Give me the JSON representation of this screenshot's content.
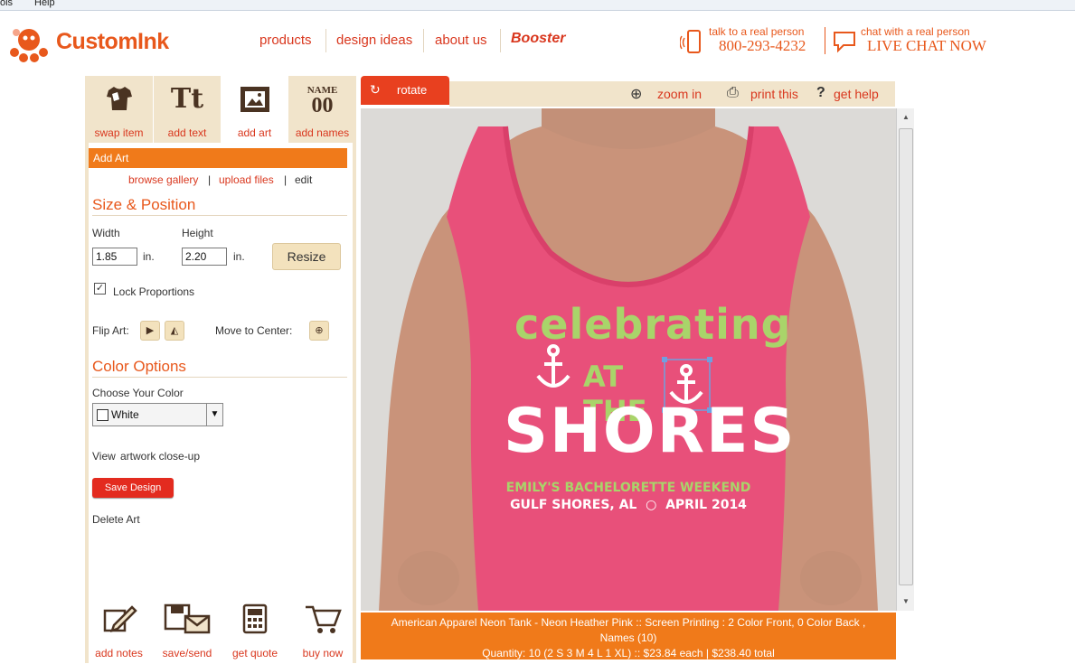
{
  "menubar": {
    "tools": "ols",
    "help": "Help"
  },
  "header": {
    "logo_text": "CustomInk",
    "nav": [
      "products",
      "design ideas",
      "about us"
    ],
    "booster": "Booster",
    "phone_label": "talk to a real person",
    "phone_number": "800-293-4232",
    "chat_label": "chat with a real person",
    "chat_action": "LIVE CHAT NOW"
  },
  "tools": [
    {
      "label": "swap item",
      "icon": "tshirt-icon"
    },
    {
      "label": "add text",
      "icon": "text-icon",
      "glyph": "Tt"
    },
    {
      "label": "add art",
      "icon": "picture-frame-icon"
    },
    {
      "label": "add names",
      "icon": "name-number-icon",
      "glyph_top": "NAME",
      "glyph_bottom": "00"
    }
  ],
  "add_art": {
    "title": "Add Art",
    "links": [
      "browse gallery",
      "upload files",
      "edit"
    ]
  },
  "size_position": {
    "title": "Size & Position",
    "width_label": "Width",
    "height_label": "Height",
    "width_value": "1.85",
    "height_value": "2.20",
    "unit": "in.",
    "resize_label": "Resize",
    "lock_label": "Lock Proportions",
    "lock_checked": "✓",
    "flip_label": "Flip Art:",
    "center_label": "Move to Center:"
  },
  "color_options": {
    "title": "Color Options",
    "choose_label": "Choose Your Color",
    "selected": "White",
    "view_prefix": "View",
    "view_link": "artwork close-up",
    "save_label": "Save Design",
    "delete_label": "Delete Art"
  },
  "bottom_tools": [
    {
      "label": "add notes",
      "icon": "notepad-pencil-icon"
    },
    {
      "label": "save/send",
      "icon": "save-mail-icon"
    },
    {
      "label": "get quote",
      "icon": "calculator-icon"
    },
    {
      "label": "buy now",
      "icon": "cart-icon"
    }
  ],
  "canvas_toolbar": {
    "rotate": "rotate",
    "zoom": "zoom in",
    "print": "print this",
    "help": "get help"
  },
  "design": {
    "line1": "celebrating",
    "line2": "AT THE",
    "line3": "SHORES",
    "line4": "EMILY'S BACHELORETTE WEEKEND",
    "line5a": "GULF SHORES, AL",
    "line5b": "APRIL 2014"
  },
  "info": {
    "line1": "American Apparel Neon Tank - Neon Heather Pink :: Screen Printing : 2 Color Front, 0 Color Back ,",
    "line2": "Names (10)",
    "line3": "Quantity: 10 (2 S 3 M 4 L 1 XL) :: $23.84 each | $238.40 total"
  },
  "colors": {
    "accent": "#e8581c",
    "orange_bar": "#f07a1a",
    "tan": "#f1e4cb",
    "shirt": "#e8507a",
    "green_text": "#a9d46a"
  }
}
